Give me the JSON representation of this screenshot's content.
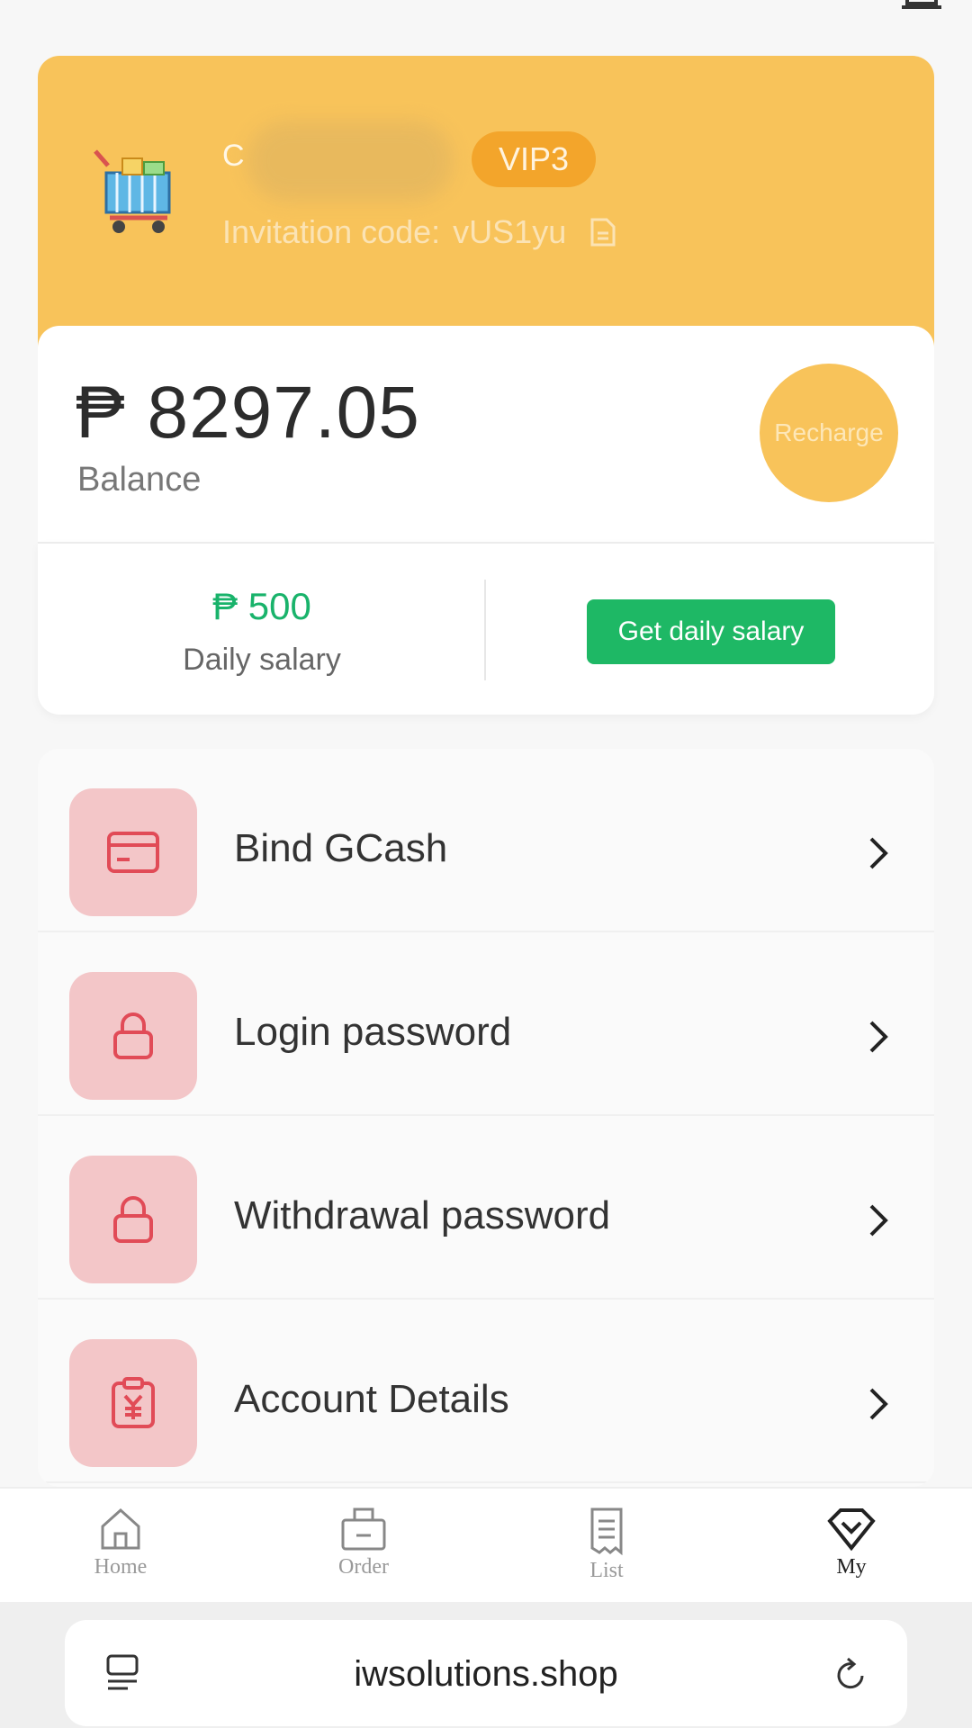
{
  "header": {
    "user_name": "C",
    "vip_level": "VIP3",
    "invitation_label": "Invitation code:",
    "invitation_code": "vUS1yu"
  },
  "balance": {
    "amount": "₱ 8297.05",
    "label": "Balance",
    "recharge_label": "Recharge"
  },
  "salary": {
    "amount": "₱ 500",
    "label": "Daily salary",
    "button_label": "Get daily salary"
  },
  "menu": {
    "items": [
      {
        "label": "Bind GCash",
        "icon": "card-icon"
      },
      {
        "label": "Login password",
        "icon": "lock-icon"
      },
      {
        "label": "Withdrawal password",
        "icon": "lock-icon"
      },
      {
        "label": "Account Details",
        "icon": "yuan-clipboard-icon"
      }
    ]
  },
  "tabbar": {
    "tabs": [
      {
        "label": "Home",
        "icon": "home-icon"
      },
      {
        "label": "Order",
        "icon": "bag-icon"
      },
      {
        "label": "List",
        "icon": "receipt-icon"
      },
      {
        "label": "My",
        "icon": "diamond-icon"
      }
    ],
    "active": "My"
  },
  "browser": {
    "url": "iwsolutions.shop"
  },
  "colors": {
    "accent_yellow": "#f8c35a",
    "vip_orange": "#f3a52b",
    "salary_green": "#19b36b",
    "button_green": "#1eb865",
    "menu_icon_bg": "#f3c6c8",
    "menu_icon_red": "#e14b57"
  }
}
